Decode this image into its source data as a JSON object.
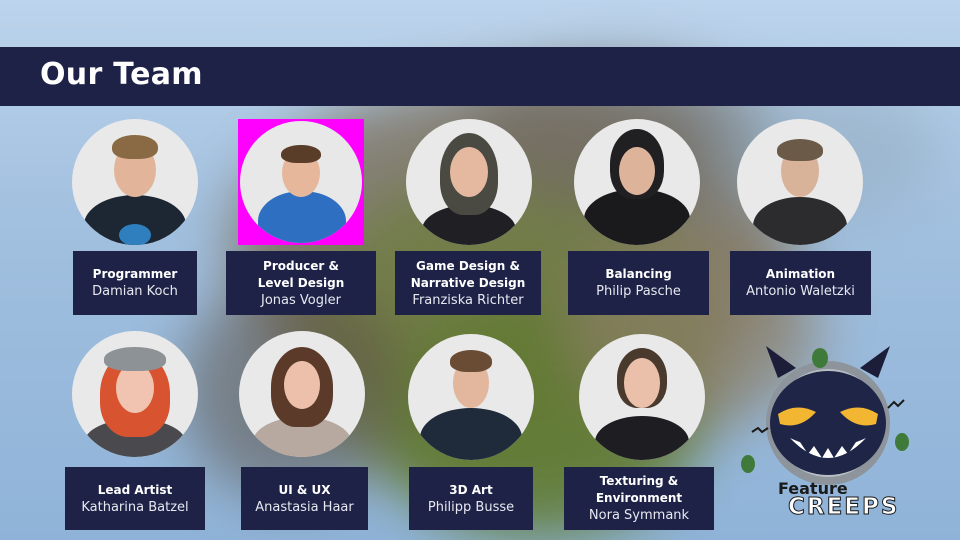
{
  "slide": {
    "title": "Our Team"
  },
  "team": [
    {
      "role": "Programmer",
      "name": "Damian Koch"
    },
    {
      "role": "Producer &\nLevel Design",
      "name": "Jonas Vogler"
    },
    {
      "role": "Game Design &\nNarrative Design",
      "name": "Franziska Richter"
    },
    {
      "role": "Balancing",
      "name": "Philip Pasche"
    },
    {
      "role": "Animation",
      "name": "Antonio Waletzki"
    },
    {
      "role": "Lead Artist",
      "name": "Katharina Batzel"
    },
    {
      "role": "UI & UX",
      "name": "Anastasia Haar"
    },
    {
      "role": "3D Art",
      "name": "Philipp Busse"
    },
    {
      "role": "Texturing &\nEnvironment",
      "name": "Nora Symmank"
    }
  ],
  "logo": {
    "line1": "Feature",
    "line2": "CREEPS"
  },
  "colors": {
    "bar": "#1e2247",
    "text": "#ffffff",
    "highlight": "#ff00ff"
  }
}
